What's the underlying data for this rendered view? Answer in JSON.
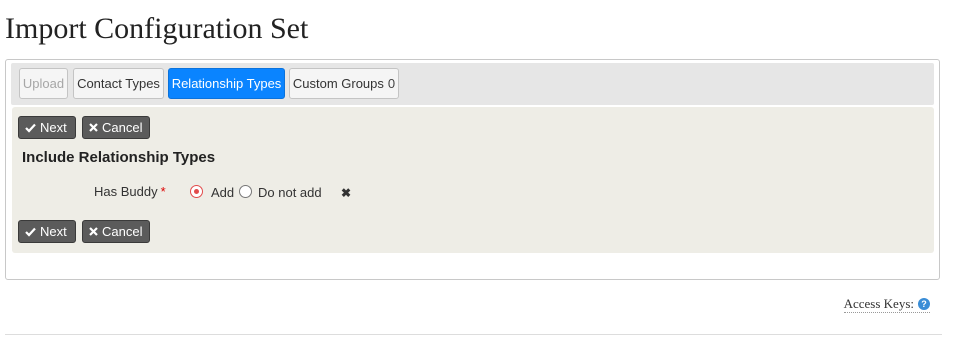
{
  "page": {
    "title": "Import Configuration Set"
  },
  "tabs": [
    {
      "label": "Upload",
      "state": "disabled"
    },
    {
      "label": "Contact Types",
      "state": "normal"
    },
    {
      "label": "Relationship Types",
      "state": "active"
    },
    {
      "label": "Custom Groups",
      "state": "normal",
      "count": "0"
    }
  ],
  "actions": {
    "next_label": "Next",
    "cancel_label": "Cancel"
  },
  "section": {
    "title": "Include Relationship Types"
  },
  "field": {
    "label": "Has Buddy",
    "required_marker": "*",
    "options": [
      {
        "label": "Add",
        "selected": true
      },
      {
        "label": "Do not add",
        "selected": false
      }
    ],
    "clear_glyph": "✖"
  },
  "footer": {
    "access_keys_label": "Access Keys:",
    "help_glyph": "?"
  },
  "colors": {
    "active_tab": "#0a84ff",
    "button_bg": "#5b5b5b",
    "panel_bg": "#eeede6",
    "radio_selected": "#e24b4b",
    "help_icon": "#3a8dd6"
  }
}
